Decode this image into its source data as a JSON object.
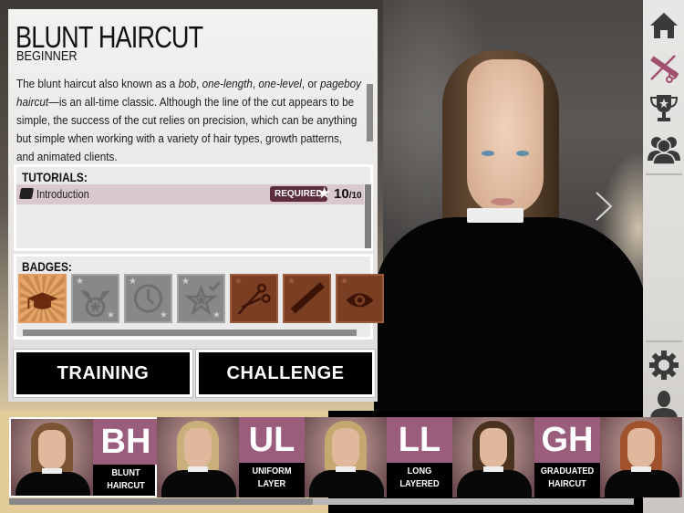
{
  "lesson": {
    "title": "BLUNT HAIRCUT",
    "level": "BEGINNER",
    "description_parts": [
      {
        "text": "The blunt haircut also known as a ",
        "italic": false
      },
      {
        "text": "bob",
        "italic": true
      },
      {
        "text": ", ",
        "italic": false
      },
      {
        "text": "one-length",
        "italic": true
      },
      {
        "text": ", ",
        "italic": false
      },
      {
        "text": "one-level",
        "italic": true
      },
      {
        "text": ", or ",
        "italic": false
      },
      {
        "text": "pageboy haircut",
        "italic": true
      },
      {
        "text": "—is an all-time classic. Although the line of the cut appears to be simple, the success of the cut relies on precision, which can be anything but simple when working with a variety of hair types, growth patterns, and animated clients.",
        "italic": false
      }
    ]
  },
  "tutorials": {
    "heading": "TUTORIALS:",
    "items": [
      {
        "icon": "notebook-icon",
        "label": "Introduction",
        "badge": "REQUIRED",
        "score": "10",
        "max": "/10"
      }
    ]
  },
  "badges": {
    "heading": "BADGES:",
    "items": [
      {
        "name": "graduation-cap",
        "state": "earned"
      },
      {
        "name": "medal-wings",
        "state": "locked"
      },
      {
        "name": "clock",
        "state": "locked"
      },
      {
        "name": "star-check",
        "state": "locked"
      },
      {
        "name": "scissors",
        "state": "bronze"
      },
      {
        "name": "comb",
        "state": "bronze"
      },
      {
        "name": "eye",
        "state": "bronze"
      }
    ]
  },
  "buttons": {
    "training": "TRAINING",
    "challenge": "CHALLENGE"
  },
  "sidebar": {
    "items": [
      {
        "icon": "home-icon",
        "active": false
      },
      {
        "icon": "scissors-comb-icon",
        "active": true
      },
      {
        "icon": "trophy-icon",
        "active": false
      },
      {
        "icon": "group-icon",
        "active": false
      },
      {
        "icon": "gear-icon",
        "active": false
      },
      {
        "icon": "user-icon",
        "active": false
      },
      {
        "icon": "book-icon",
        "active": false
      },
      {
        "icon": "help-icon",
        "active": false
      }
    ]
  },
  "carousel": {
    "items": [
      {
        "abbr": "BH",
        "name_line1": "BLUNT",
        "name_line2": "HAIRCUT",
        "selected": true,
        "hair": "#7a5433"
      },
      {
        "abbr": "UL",
        "name_line1": "UNIFORM",
        "name_line2": "LAYER",
        "selected": false,
        "hair": "#c9b07a"
      },
      {
        "abbr": "LL",
        "name_line1": "LONG",
        "name_line2": "LAYERED",
        "selected": false,
        "hair": "#c4a870"
      },
      {
        "abbr": "GH",
        "name_line1": "GRADUATED",
        "name_line2": "HAIRCUT",
        "selected": false,
        "hair": "#4a3220"
      },
      {
        "abbr": "",
        "name_line1": "",
        "name_line2": "",
        "selected": false,
        "hair": "#a0522d"
      }
    ]
  },
  "colors": {
    "accent_mauve": "#9b5d7c",
    "required_badge": "#5c2d3d",
    "tutorial_row": "#d9c8cd",
    "bronze_badge": "#7a3f22",
    "earned_badge": "#e6a56b"
  }
}
